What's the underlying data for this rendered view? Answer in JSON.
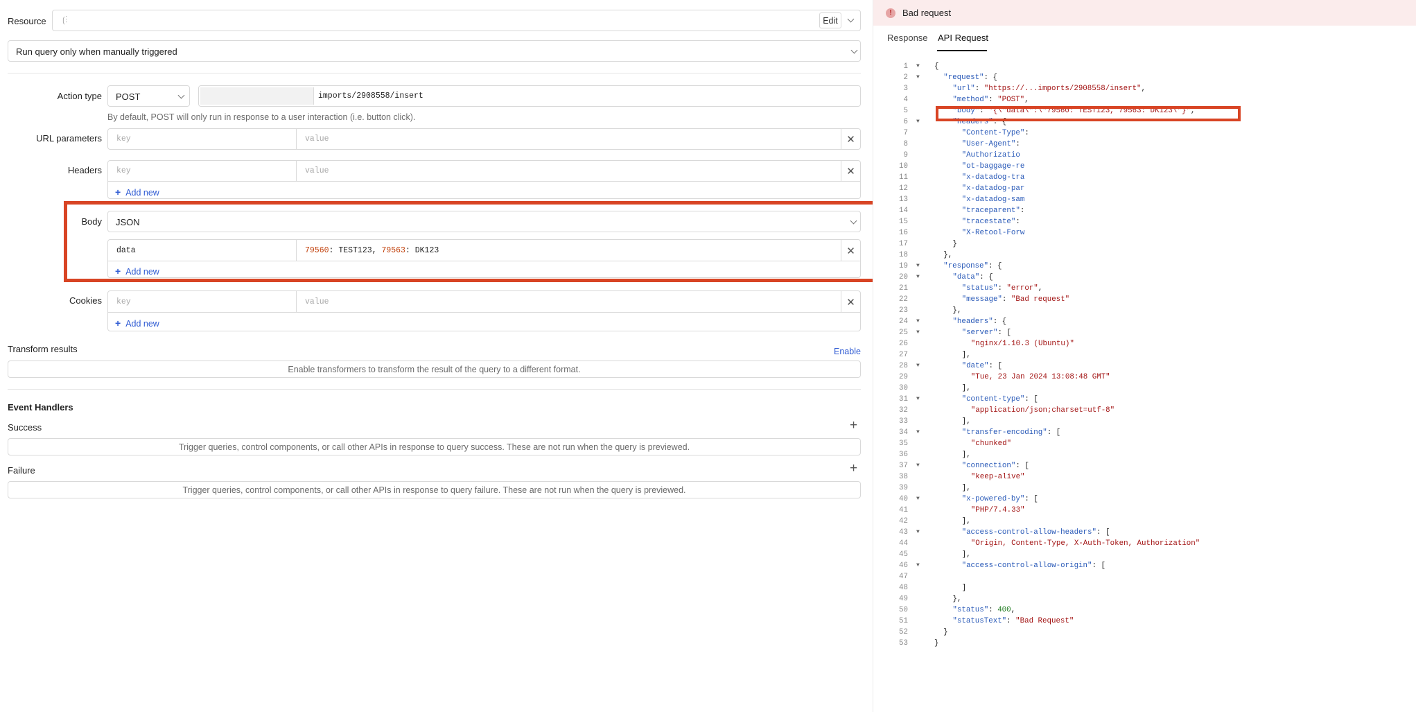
{
  "left": {
    "resource": {
      "label": "Resource",
      "value": "",
      "edit_label": "Edit"
    },
    "run_mode": {
      "value": "Run query only when manually triggered"
    },
    "action_type": {
      "label": "Action type",
      "method": "POST",
      "url_value": "imports/2908558/insert",
      "hint": "By default, POST will only run in response to a user interaction (i.e. button click)."
    },
    "url_parameters": {
      "label": "URL parameters",
      "key_placeholder": "key",
      "value_placeholder": "value"
    },
    "headers": {
      "label": "Headers",
      "key_placeholder": "key",
      "value_placeholder": "value",
      "add_new": "Add new"
    },
    "body": {
      "label": "Body",
      "type": "JSON",
      "key": "data",
      "value_parts": [
        {
          "text": "79560",
          "kind": "num"
        },
        {
          "text": ": TEST123, ",
          "kind": "plain"
        },
        {
          "text": "79563",
          "kind": "num"
        },
        {
          "text": ": DK123",
          "kind": "plain"
        }
      ],
      "add_new": "Add new"
    },
    "cookies": {
      "label": "Cookies",
      "key_placeholder": "key",
      "value_placeholder": "value",
      "add_new": "Add new"
    },
    "transform": {
      "label": "Transform results",
      "enable_label": "Enable",
      "note": "Enable transformers to transform the result of the query to a different format."
    },
    "event_handlers": {
      "title": "Event Handlers",
      "success_label": "Success",
      "success_note": "Trigger queries, control components, or call other APIs in response to query success. These are not run when the query is previewed.",
      "failure_label": "Failure",
      "failure_note": "Trigger queries, control components, or call other APIs in response to query failure. These are not run when the query is previewed."
    },
    "colors": {
      "highlight": "#d84424",
      "link": "#2f5bd3",
      "number": "#c2410c"
    }
  },
  "right": {
    "banner": {
      "text": "Bad request",
      "icon": "alert-circle-icon"
    },
    "tabs": [
      "Response",
      "API Request"
    ],
    "active_tab": "API Request",
    "code_lines": [
      {
        "n": "1",
        "fold": true,
        "indent": 0,
        "tokens": [
          [
            "{",
            "p"
          ]
        ]
      },
      {
        "n": "2",
        "fold": true,
        "indent": 1,
        "tokens": [
          [
            "\"request\"",
            "k"
          ],
          [
            ": {",
            "p"
          ]
        ]
      },
      {
        "n": "3",
        "fold": false,
        "indent": 2,
        "tokens": [
          [
            "\"url\"",
            "k"
          ],
          [
            ": ",
            "p"
          ],
          [
            "\"https://...imports/2908558/insert\"",
            "s"
          ],
          [
            ",",
            "p"
          ]
        ]
      },
      {
        "n": "4",
        "fold": false,
        "indent": 2,
        "tokens": [
          [
            "\"method\"",
            "k"
          ],
          [
            ": ",
            "p"
          ],
          [
            "\"POST\"",
            "s"
          ],
          [
            ",",
            "p"
          ]
        ]
      },
      {
        "n": "5",
        "fold": false,
        "indent": 2,
        "tokens": [
          [
            "\"body\"",
            "k"
          ],
          [
            ": ",
            "p"
          ],
          [
            "\"{\\\"data\\\":\\\"79560: TEST123, 79563: DK123\\\"}\"",
            "s"
          ],
          [
            ",",
            "p"
          ]
        ]
      },
      {
        "n": "6",
        "fold": true,
        "indent": 2,
        "tokens": [
          [
            "\"headers\"",
            "k"
          ],
          [
            ": {",
            "p"
          ]
        ]
      },
      {
        "n": "7",
        "fold": false,
        "indent": 3,
        "tokens": [
          [
            "\"Content-Type\"",
            "k"
          ],
          [
            ":",
            "p"
          ]
        ]
      },
      {
        "n": "8",
        "fold": false,
        "indent": 3,
        "tokens": [
          [
            "\"User-Agent\"",
            "k"
          ],
          [
            ":",
            "p"
          ]
        ]
      },
      {
        "n": "9",
        "fold": false,
        "indent": 3,
        "tokens": [
          [
            "\"Authorizatio",
            "k"
          ]
        ]
      },
      {
        "n": "10",
        "fold": false,
        "indent": 3,
        "tokens": [
          [
            "\"ot-baggage-re",
            "k"
          ]
        ]
      },
      {
        "n": "11",
        "fold": false,
        "indent": 3,
        "tokens": [
          [
            "\"x-datadog-tra",
            "k"
          ]
        ]
      },
      {
        "n": "12",
        "fold": false,
        "indent": 3,
        "tokens": [
          [
            "\"x-datadog-par",
            "k"
          ]
        ]
      },
      {
        "n": "13",
        "fold": false,
        "indent": 3,
        "tokens": [
          [
            "\"x-datadog-sam",
            "k"
          ]
        ]
      },
      {
        "n": "14",
        "fold": false,
        "indent": 3,
        "tokens": [
          [
            "\"traceparent\"",
            "k"
          ],
          [
            ":",
            "p"
          ]
        ]
      },
      {
        "n": "15",
        "fold": false,
        "indent": 3,
        "tokens": [
          [
            "\"tracestate\"",
            "k"
          ],
          [
            ":",
            "p"
          ]
        ]
      },
      {
        "n": "16",
        "fold": false,
        "indent": 3,
        "tokens": [
          [
            "\"X-Retool-Forw",
            "k"
          ]
        ]
      },
      {
        "n": "17",
        "fold": false,
        "indent": 2,
        "tokens": [
          [
            "}",
            "p"
          ]
        ]
      },
      {
        "n": "18",
        "fold": false,
        "indent": 1,
        "tokens": [
          [
            "},",
            "p"
          ]
        ]
      },
      {
        "n": "19",
        "fold": true,
        "indent": 1,
        "tokens": [
          [
            "\"response\"",
            "k"
          ],
          [
            ": {",
            "p"
          ]
        ]
      },
      {
        "n": "20",
        "fold": true,
        "indent": 2,
        "tokens": [
          [
            "\"data\"",
            "k"
          ],
          [
            ": {",
            "p"
          ]
        ]
      },
      {
        "n": "21",
        "fold": false,
        "indent": 3,
        "tokens": [
          [
            "\"status\"",
            "k"
          ],
          [
            ": ",
            "p"
          ],
          [
            "\"error\"",
            "s"
          ],
          [
            ",",
            "p"
          ]
        ]
      },
      {
        "n": "22",
        "fold": false,
        "indent": 3,
        "tokens": [
          [
            "\"message\"",
            "k"
          ],
          [
            ": ",
            "p"
          ],
          [
            "\"Bad request\"",
            "s"
          ]
        ]
      },
      {
        "n": "23",
        "fold": false,
        "indent": 2,
        "tokens": [
          [
            "},",
            "p"
          ]
        ]
      },
      {
        "n": "24",
        "fold": true,
        "indent": 2,
        "tokens": [
          [
            "\"headers\"",
            "k"
          ],
          [
            ": {",
            "p"
          ]
        ]
      },
      {
        "n": "25",
        "fold": true,
        "indent": 3,
        "tokens": [
          [
            "\"server\"",
            "k"
          ],
          [
            ": [",
            "p"
          ]
        ]
      },
      {
        "n": "26",
        "fold": false,
        "indent": 4,
        "tokens": [
          [
            "\"nginx/1.10.3 (Ubuntu)\"",
            "s"
          ]
        ]
      },
      {
        "n": "27",
        "fold": false,
        "indent": 3,
        "tokens": [
          [
            "],",
            "p"
          ]
        ]
      },
      {
        "n": "28",
        "fold": true,
        "indent": 3,
        "tokens": [
          [
            "\"date\"",
            "k"
          ],
          [
            ": [",
            "p"
          ]
        ]
      },
      {
        "n": "29",
        "fold": false,
        "indent": 4,
        "tokens": [
          [
            "\"Tue, 23 Jan 2024 13:08:48 GMT\"",
            "s"
          ]
        ]
      },
      {
        "n": "30",
        "fold": false,
        "indent": 3,
        "tokens": [
          [
            "],",
            "p"
          ]
        ]
      },
      {
        "n": "31",
        "fold": true,
        "indent": 3,
        "tokens": [
          [
            "\"content-type\"",
            "k"
          ],
          [
            ": [",
            "p"
          ]
        ]
      },
      {
        "n": "32",
        "fold": false,
        "indent": 4,
        "tokens": [
          [
            "\"application/json;charset=utf-8\"",
            "s"
          ]
        ]
      },
      {
        "n": "33",
        "fold": false,
        "indent": 3,
        "tokens": [
          [
            "],",
            "p"
          ]
        ]
      },
      {
        "n": "34",
        "fold": true,
        "indent": 3,
        "tokens": [
          [
            "\"transfer-encoding\"",
            "k"
          ],
          [
            ": [",
            "p"
          ]
        ]
      },
      {
        "n": "35",
        "fold": false,
        "indent": 4,
        "tokens": [
          [
            "\"chunked\"",
            "s"
          ]
        ]
      },
      {
        "n": "36",
        "fold": false,
        "indent": 3,
        "tokens": [
          [
            "],",
            "p"
          ]
        ]
      },
      {
        "n": "37",
        "fold": true,
        "indent": 3,
        "tokens": [
          [
            "\"connection\"",
            "k"
          ],
          [
            ": [",
            "p"
          ]
        ]
      },
      {
        "n": "38",
        "fold": false,
        "indent": 4,
        "tokens": [
          [
            "\"keep-alive\"",
            "s"
          ]
        ]
      },
      {
        "n": "39",
        "fold": false,
        "indent": 3,
        "tokens": [
          [
            "],",
            "p"
          ]
        ]
      },
      {
        "n": "40",
        "fold": true,
        "indent": 3,
        "tokens": [
          [
            "\"x-powered-by\"",
            "k"
          ],
          [
            ": [",
            "p"
          ]
        ]
      },
      {
        "n": "41",
        "fold": false,
        "indent": 4,
        "tokens": [
          [
            "\"PHP/7.4.33\"",
            "s"
          ]
        ]
      },
      {
        "n": "42",
        "fold": false,
        "indent": 3,
        "tokens": [
          [
            "],",
            "p"
          ]
        ]
      },
      {
        "n": "43",
        "fold": true,
        "indent": 3,
        "tokens": [
          [
            "\"access-control-allow-headers\"",
            "k"
          ],
          [
            ": [",
            "p"
          ]
        ]
      },
      {
        "n": "44",
        "fold": false,
        "indent": 4,
        "tokens": [
          [
            "\"Origin, Content-Type, X-Auth-Token, Authorization\"",
            "s"
          ]
        ]
      },
      {
        "n": "45",
        "fold": false,
        "indent": 3,
        "tokens": [
          [
            "],",
            "p"
          ]
        ]
      },
      {
        "n": "46",
        "fold": true,
        "indent": 3,
        "tokens": [
          [
            "\"access-control-allow-origin\"",
            "k"
          ],
          [
            ": [",
            "p"
          ]
        ]
      },
      {
        "n": "47",
        "fold": false,
        "indent": 4,
        "tokens": []
      },
      {
        "n": "48",
        "fold": false,
        "indent": 3,
        "tokens": [
          [
            "]",
            "p"
          ]
        ]
      },
      {
        "n": "49",
        "fold": false,
        "indent": 2,
        "tokens": [
          [
            "},",
            "p"
          ]
        ]
      },
      {
        "n": "50",
        "fold": false,
        "indent": 2,
        "tokens": [
          [
            "\"status\"",
            "k"
          ],
          [
            ": ",
            "p"
          ],
          [
            "400",
            "n"
          ],
          [
            ",",
            "p"
          ]
        ]
      },
      {
        "n": "51",
        "fold": false,
        "indent": 2,
        "tokens": [
          [
            "\"statusText\"",
            "k"
          ],
          [
            ": ",
            "p"
          ],
          [
            "\"Bad Request\"",
            "s"
          ]
        ]
      },
      {
        "n": "52",
        "fold": false,
        "indent": 1,
        "tokens": [
          [
            "}",
            "p"
          ]
        ]
      },
      {
        "n": "53",
        "fold": false,
        "indent": 0,
        "tokens": [
          [
            "}",
            "p"
          ]
        ]
      }
    ]
  }
}
